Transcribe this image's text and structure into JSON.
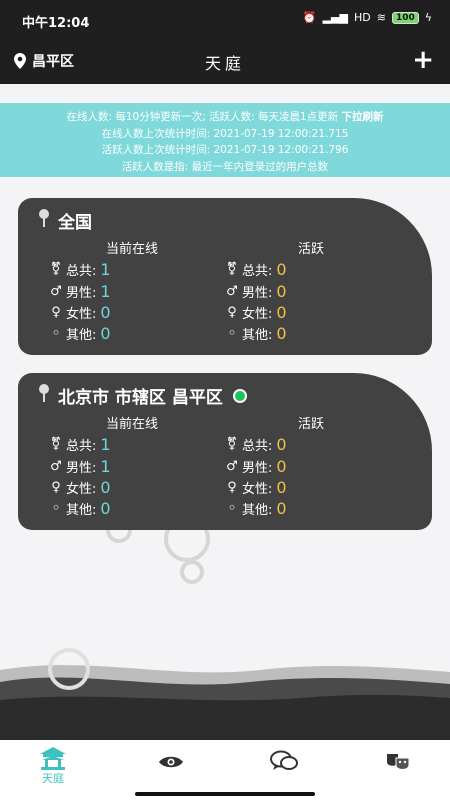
{
  "status": {
    "time": "中午12:04",
    "network": "HD",
    "battery": "100"
  },
  "header": {
    "location": "昌平区",
    "title": "天庭",
    "add_label": "+"
  },
  "notice": {
    "line1": "在线人数: 每10分钟更新一次;  活跃人数: 每天凌晨1点更新",
    "refresh": "下拉刷新",
    "line2": "在线人数上次统计时间: 2021-07-19 12:00:21.715",
    "line3": "活跃人数上次统计时间: 2021-07-19 12:00:21.796",
    "line4": "活跃人数是指: 最近一年内登录过的用户总数"
  },
  "columns": {
    "online": "当前在线",
    "active": "活跃"
  },
  "labels": {
    "total": "总共:",
    "male": "男性:",
    "female": "女性:",
    "other": "其他:"
  },
  "cards": [
    {
      "region": "全国",
      "online": {
        "total": "1",
        "male": "1",
        "female": "0",
        "other": "0"
      },
      "active": {
        "total": "0",
        "male": "0",
        "female": "0",
        "other": "0"
      }
    },
    {
      "region": "北京市 市辖区 昌平区",
      "online": {
        "total": "1",
        "male": "1",
        "female": "0",
        "other": "0"
      },
      "active": {
        "total": "0",
        "male": "0",
        "female": "0",
        "other": "0"
      }
    }
  ],
  "tabs": {
    "home": "天庭"
  },
  "colors": {
    "accent": "#40c0c0",
    "online_value": "#6ed7d8",
    "active_value": "#f0c14a",
    "notice_bg": "#7fd9db",
    "card_bg": "#424242"
  }
}
